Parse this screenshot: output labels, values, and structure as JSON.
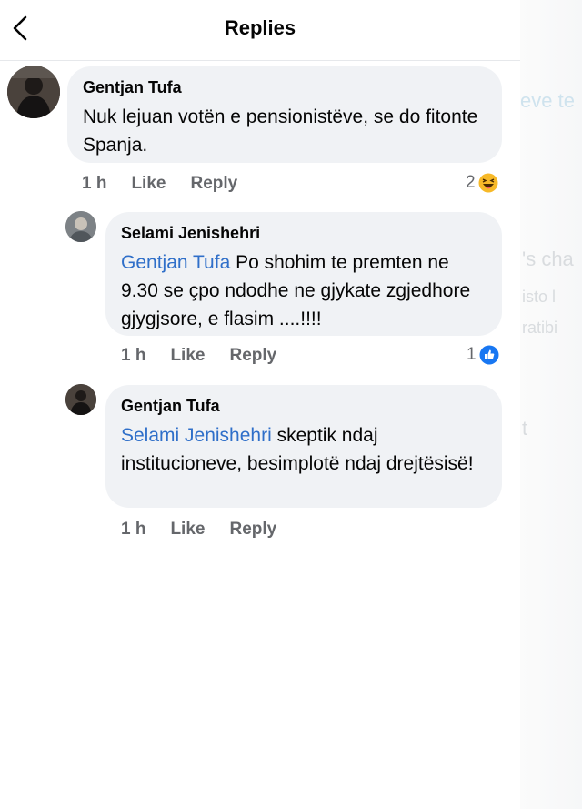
{
  "header": {
    "title": "Replies"
  },
  "comments": [
    {
      "author": "Gentjan Tufa",
      "mention": "",
      "text": "Nuk lejuan votën e pensionistëve, se do fitonte Spanja.",
      "time": "1 h",
      "like_label": "Like",
      "reply_label": "Reply",
      "reaction_count": "2",
      "reaction_icon": "haha-emoji-icon"
    },
    {
      "author": "Selami Jenishehri",
      "mention": "Gentjan Tufa",
      "text": " Po shohim te premten ne 9.30 se çpo ndodhe ne gjykate zgjedhore gjygjsore, e flasim ....!!!!",
      "time": "1 h",
      "like_label": "Like",
      "reply_label": "Reply",
      "reaction_count": "1",
      "reaction_icon": "like-thumb-icon"
    },
    {
      "author": "Gentjan Tufa",
      "mention": "Selami Jenishehri",
      "text": " skeptik ndaj institucioneve, besimplotë ndaj drejtësisë!",
      "time": "1 h",
      "like_label": "Like",
      "reply_label": "Reply",
      "reaction_count": "",
      "reaction_icon": ""
    }
  ],
  "colors": {
    "bubble": "#f0f2f5",
    "mention": "#2f6fc9",
    "meta": "#65676b",
    "like_blue": "#1877f2",
    "haha_yellow": "#f7b928"
  }
}
